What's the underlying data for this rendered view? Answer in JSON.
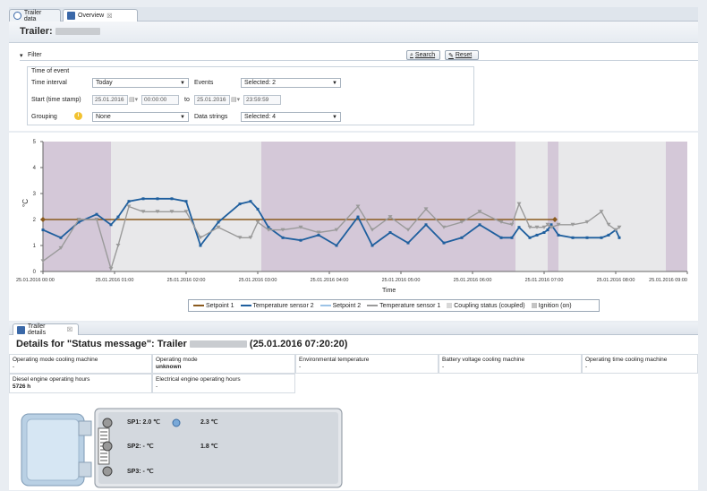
{
  "tabs": [
    {
      "label": "Trailer data",
      "icon": "info-icon"
    },
    {
      "label": "Overview",
      "icon": "overview-icon",
      "close": "☒"
    }
  ],
  "page": {
    "title": "Trailer:"
  },
  "filter": {
    "header": "Filter",
    "search_label": "Search",
    "reset_label": "Reset",
    "group_title": "Time of event",
    "time_interval_label": "Time interval",
    "time_interval_value": "Today",
    "events_label": "Events",
    "events_value": "Selected: 2",
    "start_label": "Start (time stamp)",
    "start_date": "25.01.2016",
    "start_time": "00:00:00",
    "to_label": "to",
    "end_date": "25.01.2016",
    "end_time": "23:59:59",
    "grouping_label": "Grouping",
    "grouping_value": "None",
    "data_strings_label": "Data strings",
    "data_strings_value": "Selected: 4"
  },
  "chart_data": {
    "type": "line",
    "xlabel": "Time",
    "ylabel": "°C",
    "ylim": [
      0,
      5
    ],
    "yticks": [
      "0",
      "1",
      "2",
      "3",
      "4",
      "5"
    ],
    "x_ticks": [
      "25.01.2016 00:00",
      "25.01.2016 01:00",
      "25.01.2016 02:00",
      "25.01.2016 03:00",
      "25.01.2016 04:00",
      "25.01.2016 05:00",
      "25.01.2016 06:00",
      "25.01.2016 07:00",
      "25.01.2016 08:00",
      "25.01.2016 09:00"
    ],
    "xlim": [
      0,
      9
    ],
    "shaded_ranges": [
      [
        0,
        0.95
      ],
      [
        3.05,
        6.6
      ],
      [
        7.05,
        7.2
      ],
      [
        8.7,
        9.0
      ]
    ],
    "series": [
      {
        "name": "Setpoint 1",
        "color": "#8a5a1e",
        "x": [
          0,
          7.15
        ],
        "values": [
          2.0,
          2.0
        ]
      },
      {
        "name": "Temperature sensor 2",
        "color": "#1f5f9e",
        "x": [
          0,
          0.25,
          0.5,
          0.75,
          0.95,
          1.05,
          1.2,
          1.4,
          1.6,
          1.8,
          2.0,
          2.2,
          2.45,
          2.75,
          2.9,
          3.0,
          3.15,
          3.35,
          3.6,
          3.85,
          4.1,
          4.4,
          4.6,
          4.85,
          5.1,
          5.35,
          5.6,
          5.85,
          6.1,
          6.4,
          6.55,
          6.65,
          6.8,
          6.9,
          7.0,
          7.05,
          7.1,
          7.2,
          7.4,
          7.6,
          7.8,
          7.9,
          8.0,
          8.05
        ],
        "values": [
          1.6,
          1.3,
          1.9,
          2.2,
          1.8,
          2.1,
          2.7,
          2.8,
          2.8,
          2.8,
          2.7,
          1.0,
          1.9,
          2.6,
          2.7,
          2.4,
          1.7,
          1.3,
          1.2,
          1.4,
          1.0,
          2.1,
          1.0,
          1.5,
          1.1,
          1.8,
          1.1,
          1.3,
          1.8,
          1.3,
          1.3,
          1.7,
          1.3,
          1.4,
          1.5,
          1.6,
          1.8,
          1.4,
          1.3,
          1.3,
          1.3,
          1.4,
          1.6,
          1.3
        ]
      },
      {
        "name": "Setpoint 2",
        "color": "#9cc3e6",
        "x": [],
        "values": []
      },
      {
        "name": "Temperature sensor 1",
        "color": "#9a9a9a",
        "x": [
          0,
          0.25,
          0.5,
          0.75,
          0.95,
          1.05,
          1.2,
          1.4,
          1.6,
          1.8,
          2.0,
          2.2,
          2.45,
          2.75,
          2.9,
          3.0,
          3.15,
          3.35,
          3.6,
          3.85,
          4.1,
          4.4,
          4.6,
          4.85,
          5.1,
          5.35,
          5.6,
          5.85,
          6.1,
          6.4,
          6.55,
          6.65,
          6.8,
          6.9,
          7.0,
          7.05,
          7.1,
          7.2,
          7.4,
          7.6,
          7.8,
          7.9,
          8.0,
          8.05
        ],
        "values": [
          0.4,
          0.9,
          2.0,
          2.0,
          0.1,
          1.0,
          2.5,
          2.3,
          2.3,
          2.3,
          2.3,
          1.3,
          1.7,
          1.3,
          1.3,
          1.9,
          1.6,
          1.6,
          1.7,
          1.5,
          1.6,
          2.5,
          1.6,
          2.1,
          1.6,
          2.4,
          1.7,
          1.9,
          2.3,
          1.9,
          1.8,
          2.6,
          1.7,
          1.7,
          1.7,
          1.8,
          1.7,
          1.8,
          1.8,
          1.9,
          2.3,
          1.8,
          1.6,
          1.7
        ]
      },
      {
        "name": "Coupling status (coupled)",
        "color": "#cfcfcf",
        "x": [],
        "values": []
      },
      {
        "name": "Ignition (on)",
        "color": "#bdbdbd",
        "x": [],
        "values": []
      }
    ],
    "legend_position": "bottom-center",
    "grid": false
  },
  "details": {
    "tab_label": "Trailer details",
    "title": "Details for \"Status message\": Trailer",
    "title_suffix": "(25.01.2016 07:20:20)",
    "cells": [
      {
        "label": "Operating mode cooling machine",
        "value": "-"
      },
      {
        "label": "Operating mode",
        "value": "unknown"
      },
      {
        "label": "Environmental temperature",
        "value": "-"
      },
      {
        "label": "Battery voltage cooling machine",
        "value": "-"
      },
      {
        "label": "Operating time cooling machine",
        "value": "-"
      },
      {
        "label": "Diesel engine operating hours",
        "value": "5726 h"
      },
      {
        "label": "Electrical engine operating hours",
        "value": "-"
      }
    ],
    "trailer": {
      "sp1": "SP1: 2.0 ℃",
      "sp1_temp": "2.3 ℃",
      "sp2": "SP2: - ℃",
      "sp2_temp": "1.8 ℃",
      "sp3": "SP3: - ℃"
    }
  }
}
